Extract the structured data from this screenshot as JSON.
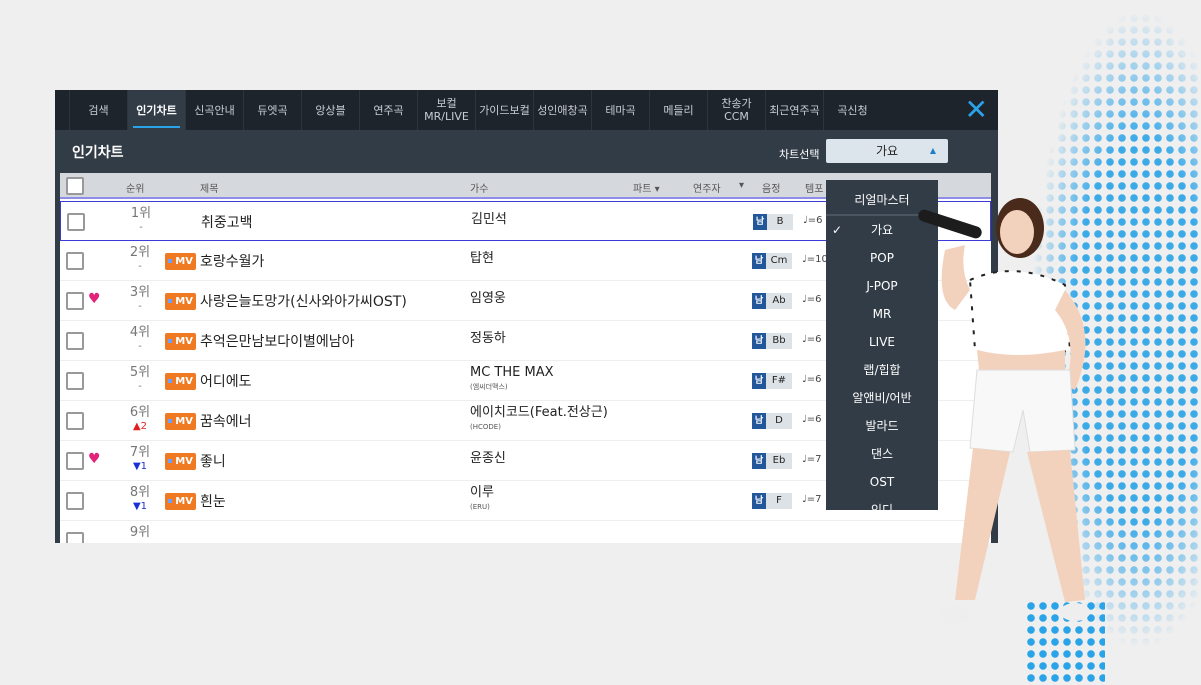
{
  "nav": {
    "tabs": [
      {
        "label": "검색"
      },
      {
        "label": "인기차트",
        "active": true
      },
      {
        "label": "신곡안내"
      },
      {
        "label": "듀엣곡"
      },
      {
        "label": "앙상블"
      },
      {
        "label": "연주곡"
      },
      {
        "label": "보컬\nMR/LIVE"
      },
      {
        "label": "가이드보컬"
      },
      {
        "label": "성인애창곡"
      },
      {
        "label": "테마곡"
      },
      {
        "label": "메들리"
      },
      {
        "label": "찬송가\nCCM"
      },
      {
        "label": "최근연주곡"
      },
      {
        "label": "곡신청"
      }
    ]
  },
  "page_title": "인기차트",
  "chart_select": {
    "label": "차트선택",
    "value": "가요"
  },
  "columns": {
    "rank": "순위",
    "title": "제목",
    "singer": "가수",
    "part": "파트 ▾",
    "player": "연주자",
    "player_arrow": "▾",
    "key": "음정",
    "tempo": "템포"
  },
  "rows": [
    {
      "rank": "1위",
      "change": "-",
      "title": "취중고백",
      "singer": "김민석",
      "sub": "",
      "mv": false,
      "heart": false,
      "gender": "남",
      "key": "B",
      "tempo": "♩=6"
    },
    {
      "rank": "2위",
      "change": "-",
      "title": "호랑수월가",
      "singer": "탑현",
      "sub": "",
      "mv": true,
      "heart": false,
      "gender": "남",
      "key": "Cm",
      "tempo": "♩=10"
    },
    {
      "rank": "3위",
      "change": "-",
      "title": "사랑은늘도망가(신사와아가씨OST)",
      "singer": "임영웅",
      "sub": "",
      "mv": true,
      "heart": true,
      "gender": "남",
      "key": "Ab",
      "tempo": "♩=6"
    },
    {
      "rank": "4위",
      "change": "-",
      "title": "추억은만남보다이별에남아",
      "singer": "정동하",
      "sub": "",
      "mv": true,
      "heart": false,
      "gender": "남",
      "key": "Bb",
      "tempo": "♩=6"
    },
    {
      "rank": "5위",
      "change": "-",
      "title": "어디에도",
      "singer": "MC THE MAX",
      "sub": "(엠씨더맥스)",
      "mv": true,
      "heart": false,
      "gender": "남",
      "key": "F#",
      "tempo": "♩=6"
    },
    {
      "rank": "6위",
      "change": "▲2",
      "title": "꿈속에너",
      "singer": "에이치코드(Feat.전상근)",
      "sub": "(HCODE)",
      "mv": true,
      "heart": false,
      "gender": "남",
      "key": "D",
      "tempo": "♩=6"
    },
    {
      "rank": "7위",
      "change": "▼1",
      "title": "좋니",
      "singer": "윤종신",
      "sub": "",
      "mv": true,
      "heart": true,
      "gender": "남",
      "key": "Eb",
      "tempo": "♩=7"
    },
    {
      "rank": "8위",
      "change": "▼1",
      "title": "흰눈",
      "singer": "이루",
      "sub": "(ERU)",
      "mv": true,
      "heart": false,
      "gender": "남",
      "key": "F",
      "tempo": "♩=7"
    },
    {
      "rank": "9위",
      "change": "",
      "title": "",
      "singer": "",
      "sub": "",
      "mv": false,
      "heart": false,
      "gender": "",
      "key": "",
      "tempo": ""
    }
  ],
  "mv_label": "MV",
  "dropdown": {
    "header": "리얼마스터",
    "items": [
      "가요",
      "POP",
      "J-POP",
      "MR",
      "LIVE",
      "랩/힙합",
      "알앤비/어반",
      "발라드",
      "댄스",
      "OST",
      "인디"
    ],
    "selected": "가요"
  },
  "colors": {
    "accent": "#2aa3e8",
    "mv": "#f07a22",
    "up": "#e02020",
    "down": "#1a2fd8"
  }
}
